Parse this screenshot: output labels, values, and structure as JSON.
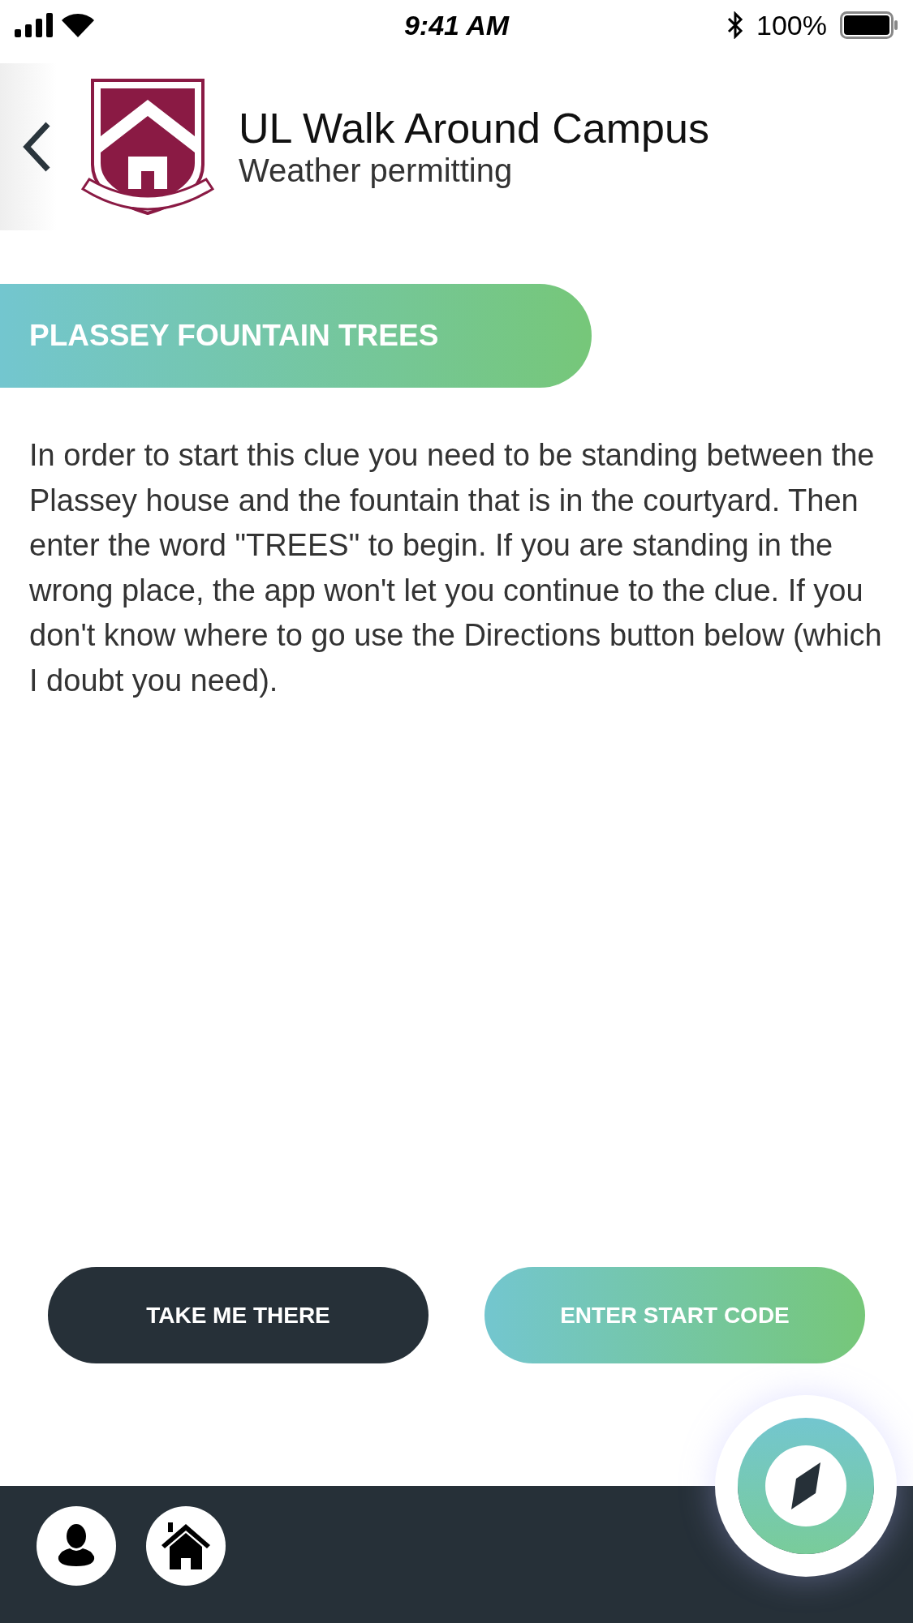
{
  "status_bar": {
    "time": "9:41 AM",
    "battery": "100%"
  },
  "header": {
    "title": "UL Walk Around Campus",
    "subtitle": "Weather permitting"
  },
  "clue": {
    "title": "PLASSEY FOUNTAIN TREES",
    "description": "In order to start this clue you need to be standing between the Plassey house and the fountain that is in the courtyard. Then enter the word \"TREES\" to begin. If you are standing in the wrong place, the app won't let you continue to the clue. If you don't know where to go use the Directions button below (which I doubt you need)."
  },
  "buttons": [
    {
      "label": "TAKE ME THERE",
      "kind": "dark"
    },
    {
      "label": "ENTER START CODE",
      "kind": "gradient"
    }
  ]
}
